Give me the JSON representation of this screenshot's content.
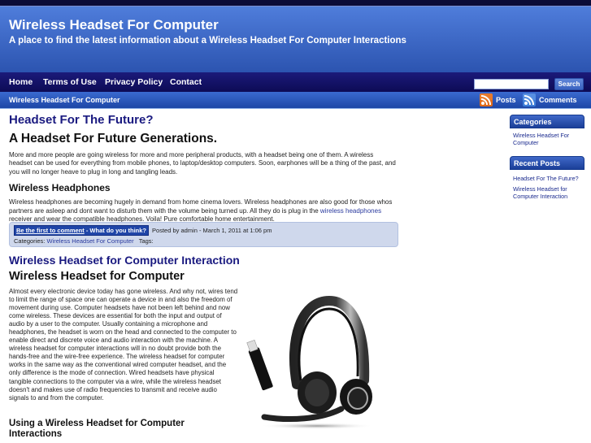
{
  "header": {
    "title": "Wireless Headset For Computer",
    "tagline": "A place to find the latest information about a Wireless Headset For Computer Interactions"
  },
  "nav": {
    "items": [
      "Home",
      "Terms of Use",
      "Privacy Policy",
      "Contact"
    ],
    "search_placeholder": "",
    "search_value": "",
    "search_button": "Search"
  },
  "subbar": {
    "breadcrumb": "Wireless Headset For Computer",
    "feeds": [
      {
        "label": "Posts",
        "icon": "rss-icon",
        "color": "#e06a1a"
      },
      {
        "label": "Comments",
        "icon": "rss-icon",
        "color": "#3f7fd8"
      }
    ]
  },
  "post1": {
    "title": "Headset For The Future?",
    "heading": "A Headset For Future Generations.",
    "para1": "More and more people are going wireless for more and more peripheral products, with a headset being one of them.  A wireless headset can be used for everything from mobile phones, to laptop/desktop computers.  Soon, earphones will be a thing of the past, and you will no longer heave to plug in long and tangling leads.",
    "subheading": "Wireless Headphones",
    "para2_before": "Wireless headphones are becoming hugely in demand from home cinema lovers.  Wireless headphones are also good for those whos partners are asleep and dont want to disturb them with the volume being turned up.  All they do is plug in the ",
    "para2_link": "wireless headphones",
    "para2_after": " receiver and wear the compatible headphones. Voila!  Pure comfortable home entertainment.",
    "meta": {
      "comment_link": "Be the first to comment",
      "comment_suffix": " - What do you think?",
      "posted": "Posted by admin - March 1, 2011 at 1:06 pm",
      "categories_label": "Categories:",
      "category": "Wireless Headset For Computer",
      "tags_label": "Tags:"
    }
  },
  "post2": {
    "title": "Wireless Headset for Computer Interaction",
    "heading": "Wireless Headset for Computer",
    "para": "Almost every electronic device today has gone wireless. And why not, wires tend to limit the range of space one can operate a device in and also the freedom of movement during use. Computer headsets have not been left behind and now come wireless. These devices are essential for both the input and output of audio by a user to the computer. Usually containing a microphone and headphones, the headset is worn on the head and connected to the computer to enable direct and discrete voice and audio interaction with the machine. A wireless headset for computer interactions will in no doubt provide both the hands-free and the wire-free experience. The wireless headset for computer works in the same way as the conventional wired computer headset, and the only difference is the mode of connection. Wired headsets have physical tangible connections to the computer via a wire, while the wireless headset doesn't and makes use of radio frequencies to transmit and receive audio signals to and from the computer.",
    "subheading": "Using a Wireless Headset for Computer Interactions",
    "image": "headset-with-usb-dongle"
  },
  "sidebar": {
    "categories_title": "Categories",
    "categories": [
      "Wireless Headset For Computer"
    ],
    "recent_title": "Recent Posts",
    "recent": [
      "Headset For The Future?",
      "Wireless Headset for Computer Interaction"
    ]
  }
}
